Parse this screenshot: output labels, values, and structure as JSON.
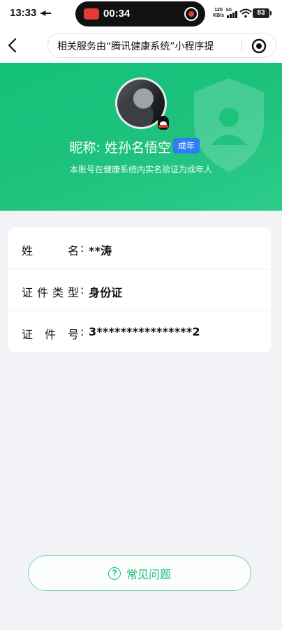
{
  "status_bar": {
    "time": "13:33",
    "recording_time": "00:34",
    "net_speed": "120",
    "net_unit": "KB/s",
    "network_type": "5G",
    "battery": "83"
  },
  "nav": {
    "title": "相关服务由“腾讯健康系统”小程序提"
  },
  "profile": {
    "nickname": "昵称: 姓孙名悟空",
    "badge": "成年",
    "note": "本账号在健康系统内实名验证为成年人"
  },
  "info": {
    "rows": [
      {
        "label": "姓名",
        "value": "**涛"
      },
      {
        "label": "证件类型",
        "value": "身份证"
      },
      {
        "label": "证件号",
        "value": "3****************2"
      }
    ]
  },
  "faq": {
    "label": "常见问题"
  },
  "colors": {
    "brand_green": "#1ec27d",
    "badge_blue": "#2f7df3",
    "record_red": "#e53935"
  }
}
